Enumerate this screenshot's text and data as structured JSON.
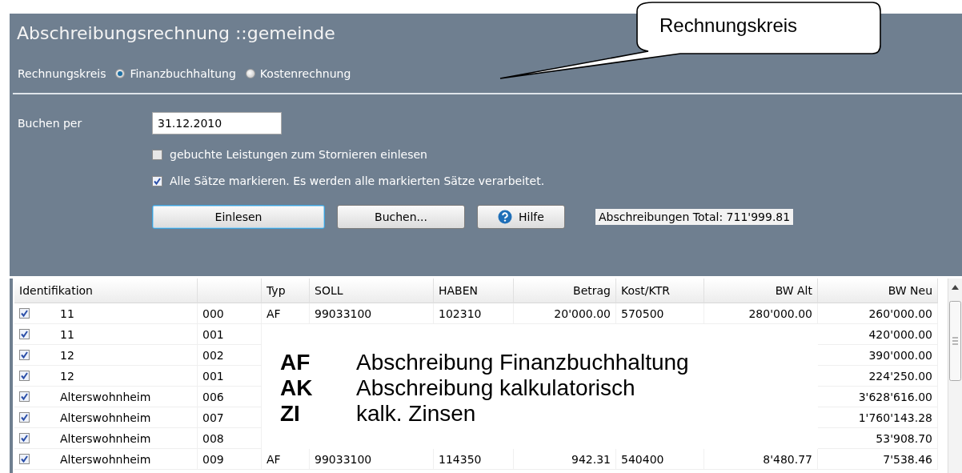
{
  "title": "Abschreibungsrechnung ::gemeinde",
  "rechnungskreis": {
    "label": "Rechnungskreis",
    "options": [
      {
        "label": "Finanzbuchhaltung",
        "selected": true
      },
      {
        "label": "Kostenrechnung",
        "selected": false
      }
    ]
  },
  "buchen_per": {
    "label": "Buchen per",
    "value": "31.12.2010"
  },
  "checkboxes": [
    {
      "label": "gebuchte Leistungen zum Stornieren einlesen",
      "checked": false
    },
    {
      "label": "Alle Sätze markieren. Es werden alle markierten Sätze verarbeitet.",
      "checked": true
    }
  ],
  "buttons": [
    {
      "label": "Einlesen",
      "kind": "default"
    },
    {
      "label": "Buchen...",
      "kind": "normal"
    },
    {
      "label": "Hilfe",
      "kind": "help"
    }
  ],
  "total": "Abschreibungen Total: 711'999.81",
  "table": {
    "columns": [
      {
        "label": "Identifikation"
      },
      {},
      {
        "label": "Typ"
      },
      {
        "label": "SOLL"
      },
      {
        "label": "HABEN"
      },
      {
        "label": "Betrag"
      },
      {
        "label": "Kost/KTR"
      },
      {
        "label": "BW Alt"
      },
      {
        "label": "BW Neu"
      }
    ],
    "rows": [
      {
        "checked": true,
        "cells": [
          "11",
          "000",
          "AF",
          "99033100",
          "102310",
          "20'000.00",
          "570500",
          "280'000.00",
          "260'000.00"
        ]
      },
      {
        "checked": true,
        "cells": [
          "11",
          "001",
          null,
          null,
          null,
          null,
          null,
          null,
          "420'000.00"
        ]
      },
      {
        "checked": true,
        "cells": [
          "12",
          "002",
          null,
          null,
          null,
          null,
          null,
          null,
          "390'000.00"
        ]
      },
      {
        "checked": true,
        "cells": [
          "12",
          "001",
          null,
          null,
          null,
          null,
          null,
          null,
          "224'250.00"
        ]
      },
      {
        "checked": true,
        "cells": [
          "Alterswohnheim",
          "006",
          null,
          null,
          null,
          null,
          null,
          null,
          "3'628'616.00"
        ]
      },
      {
        "checked": true,
        "cells": [
          "Alterswohnheim",
          "007",
          null,
          null,
          null,
          null,
          null,
          null,
          "1'760'143.28"
        ]
      },
      {
        "checked": true,
        "cells": [
          "Alterswohnheim",
          "008",
          null,
          null,
          null,
          null,
          null,
          null,
          "53'908.70"
        ]
      },
      {
        "checked": true,
        "cells": [
          "Alterswohnheim",
          "009",
          "AF",
          "99033100",
          "114350",
          "942.31",
          "540400",
          "8'480.77",
          "7'538.46"
        ]
      }
    ]
  },
  "callout": {
    "text": "Rechnungskreis"
  },
  "legend": [
    {
      "code": "AF",
      "text": "Abschreibung Finanzbuchhaltung"
    },
    {
      "code": "AK",
      "text": "Abschreibung kalkulatorisch"
    },
    {
      "code": "ZI",
      "text": "kalk. Zinsen"
    }
  ]
}
